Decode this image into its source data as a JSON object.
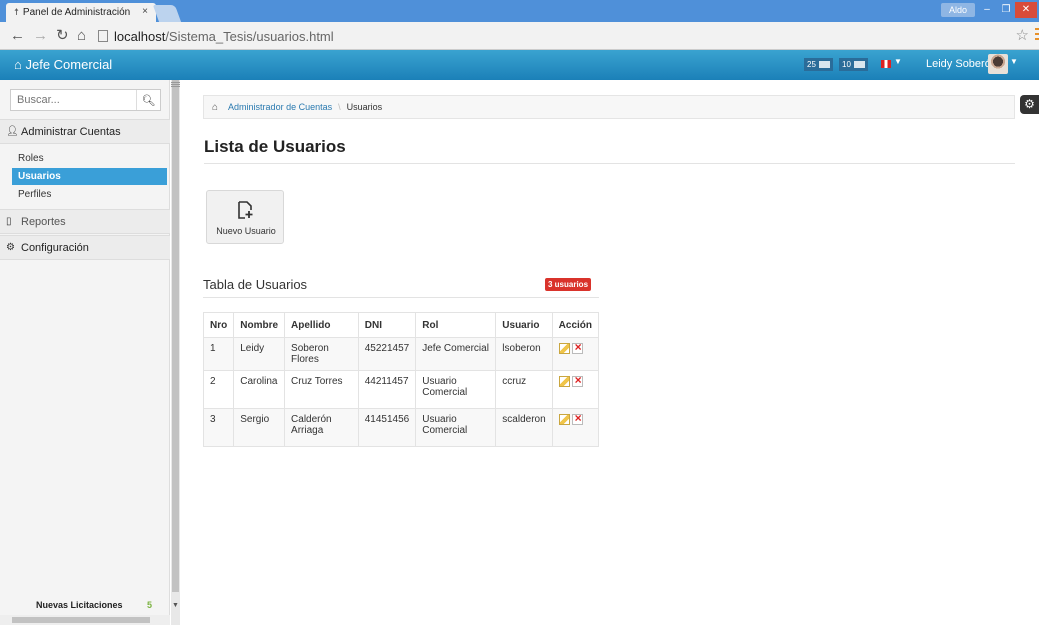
{
  "browser": {
    "tab_title": "Panel de Administración",
    "tab_close": "×",
    "window_user": "Aldo",
    "url_host": "localhost",
    "url_path": "/Sistema_Tesis/usuarios.html"
  },
  "header": {
    "brand": "Jefe Comercial",
    "messages_count": "25",
    "events_count": "10",
    "user_name": "Leidy Soberón"
  },
  "sidebar": {
    "search_placeholder": "Buscar...",
    "section_accounts": "Administrar Cuentas",
    "items": [
      {
        "label": "Roles"
      },
      {
        "label": "Usuarios"
      },
      {
        "label": "Perfiles"
      }
    ],
    "section_reports": "Reportes",
    "section_config": "Configuración",
    "footer_label": "Nuevas Licitaciones",
    "footer_count": "5"
  },
  "breadcrumb": {
    "parent": "Administrador de Cuentas",
    "current": "Usuarios"
  },
  "page_title": "Lista de Usuarios",
  "new_user_label": "Nuevo Usuario",
  "table": {
    "title": "Tabla de Usuarios",
    "badge": "3 usuarios",
    "headers": [
      "Nro",
      "Nombre",
      "Apellido",
      "DNI",
      "Rol",
      "Usuario",
      "Acción"
    ],
    "rows": [
      [
        "1",
        "Leidy",
        "Soberon Flores",
        "45221457",
        "Jefe Comercial",
        "lsoberon"
      ],
      [
        "2",
        "Carolina",
        "Cruz Torres",
        "44211457",
        "Usuario Comercial",
        "ccruz"
      ],
      [
        "3",
        "Sergio",
        "Calderón Arriaga",
        "41451456",
        "Usuario Comercial",
        "scalderon"
      ]
    ]
  }
}
